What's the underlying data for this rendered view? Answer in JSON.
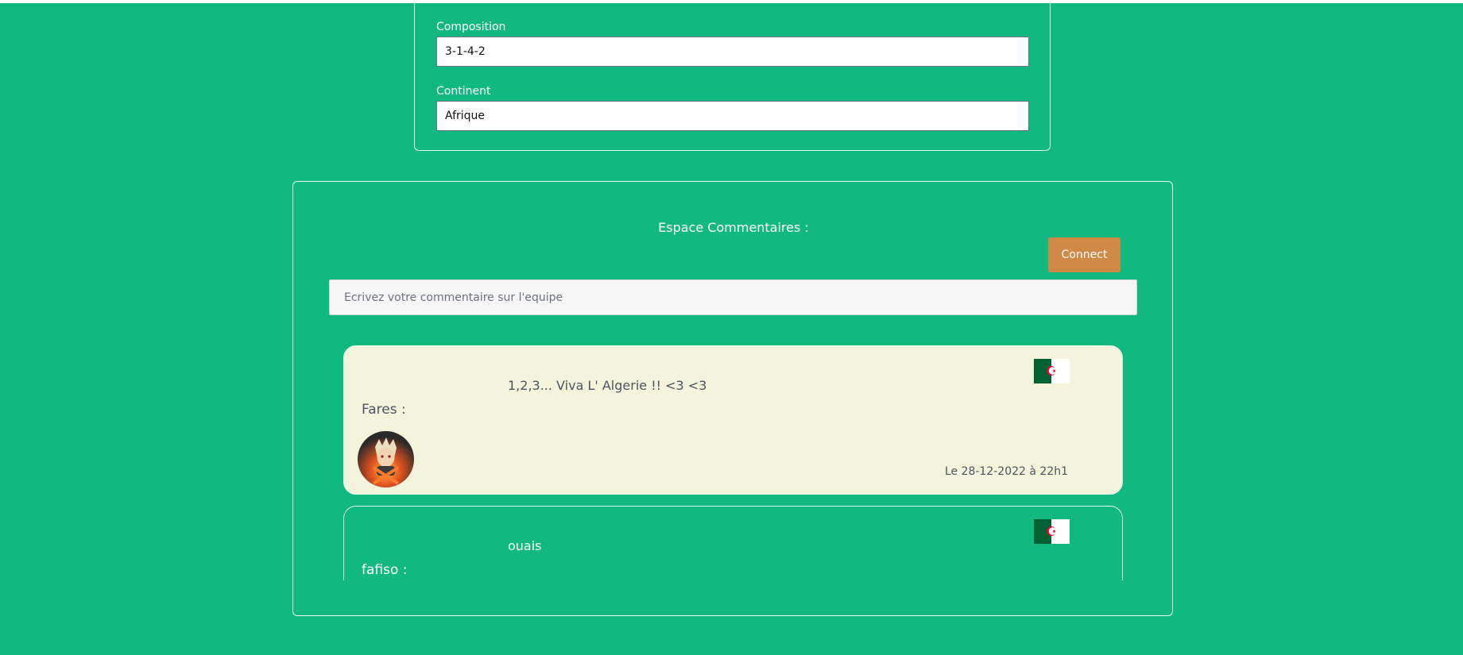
{
  "team_form": {
    "fields": [
      {
        "label": "Composition",
        "value": "3-1-4-2"
      },
      {
        "label": "Continent",
        "value": "Afrique"
      }
    ]
  },
  "comments_section": {
    "title": "Espace Commentaires :",
    "connect_label": "Connect",
    "input_placeholder": "Ecrivez votre commentaire sur l'equipe",
    "comments": [
      {
        "author": "Fares :",
        "text": "1,2,3... Viva L' Algerie !! <3 <3",
        "date": "Le 28-12-2022 à 22h1",
        "flag": "algeria-flag-icon",
        "avatar": "user-avatar"
      },
      {
        "author": "fafiso :",
        "text": "ouais",
        "flag": "algeria-flag-icon"
      }
    ]
  },
  "colors": {
    "background": "#11b981",
    "connect_button": "#d18a45",
    "highlight_comment": "#f4f3dc"
  }
}
